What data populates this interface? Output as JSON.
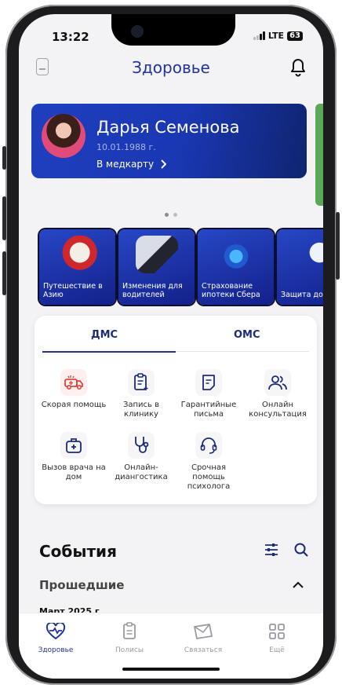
{
  "status": {
    "time": "13:22",
    "network": "LTE",
    "battery": "63"
  },
  "header": {
    "title": "Здоровье"
  },
  "profile_card": {
    "name": "Дарья Семенова",
    "birthdate": "10.01.1988 г.",
    "link": "В медкарту"
  },
  "promos": [
    {
      "label": "Путешествие в Азию"
    },
    {
      "label": "Изменения для водителей"
    },
    {
      "label": "Страхование ипотеки Сбера"
    },
    {
      "label": "Защита до"
    }
  ],
  "insurance_tabs": [
    {
      "label": "ДМС"
    },
    {
      "label": "ОМС"
    }
  ],
  "services": [
    {
      "label": "Скорая помощь",
      "icon": "ambulance-icon"
    },
    {
      "label": "Запись в клинику",
      "icon": "clipboard-icon"
    },
    {
      "label": "Гарантийные письма",
      "icon": "letter-icon"
    },
    {
      "label": "Онлайн консультация",
      "icon": "people-icon"
    },
    {
      "label": "Вызов врача на дом",
      "icon": "medical-bag-icon"
    },
    {
      "label": "Онлайн-диангостика",
      "icon": "stethoscope-icon"
    },
    {
      "label": "Срочная помощь психолога",
      "icon": "headset-icon"
    }
  ],
  "events": {
    "title": "События",
    "past_label": "Прошедшие",
    "month": "Март 2025 г."
  },
  "tabbar": [
    {
      "label": "Здоровье",
      "icon": "heart-icon",
      "active": true
    },
    {
      "label": "Полисы",
      "icon": "document-icon"
    },
    {
      "label": "Связаться",
      "icon": "envelope-icon"
    },
    {
      "label": "Ещё",
      "icon": "grid-icon"
    }
  ],
  "colors": {
    "accent": "#22339A",
    "card": "#1F3FBF",
    "danger": "#E0463C"
  }
}
